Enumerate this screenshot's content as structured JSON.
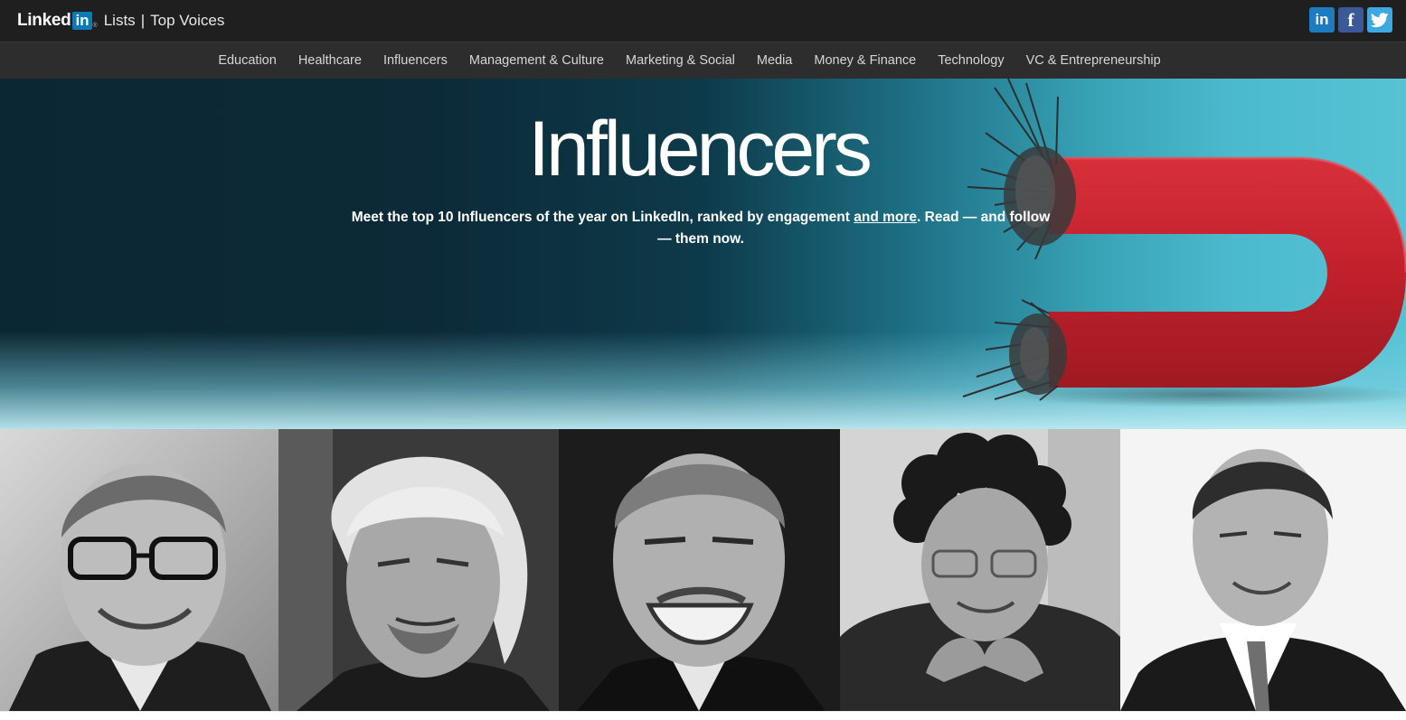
{
  "header": {
    "brand_linked": "Linked",
    "brand_in": "in",
    "brand_reg": "®",
    "crumb_lists": "Lists",
    "crumb_sep": "|",
    "crumb_top_voices": "Top Voices",
    "social": {
      "linkedin": "in",
      "facebook": "f",
      "twitter": "t"
    }
  },
  "nav": {
    "items": [
      "Education",
      "Healthcare",
      "Influencers",
      "Management & Culture",
      "Marketing & Social",
      "Media",
      "Money & Finance",
      "Technology",
      "VC & Entrepreneurship"
    ]
  },
  "hero": {
    "title": "Influencers",
    "subtitle_before": "Meet the top 10 Influencers of the year on LinkedIn, ranked by engagement ",
    "subtitle_link": "and more",
    "subtitle_after": ". Read — and follow — them now."
  },
  "colors": {
    "topbar": "#1f1f1f",
    "nav": "#2d2d2d",
    "hero_dark": "#0b2733",
    "hero_light": "#56c3d4",
    "magnet_red": "#c5202a",
    "linkedin_blue": "#1f7bbf",
    "facebook_blue": "#3b5998",
    "twitter_blue": "#3fa8e0"
  },
  "icons": [
    "linkedin-icon",
    "facebook-icon",
    "twitter-icon",
    "magnet-illustration"
  ],
  "people_count": 5
}
